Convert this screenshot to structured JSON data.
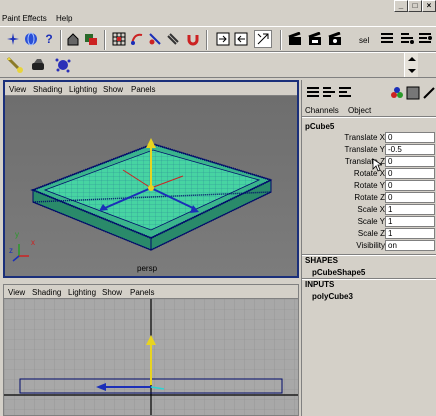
{
  "menubar": {
    "items": [
      "Paint Effects",
      "Help"
    ],
    "window_buttons": [
      "_",
      "□",
      "×"
    ]
  },
  "toolbar": {
    "sel_label": "sel"
  },
  "viewport_top": {
    "menu": [
      "View",
      "Shading",
      "Lighting",
      "Show",
      "Panels"
    ],
    "camera_label": "persp",
    "axis_labels": [
      "y",
      "x",
      "z"
    ]
  },
  "viewport_bottom": {
    "menu": [
      "View",
      "Shading",
      "Lighting",
      "Show",
      "Panels"
    ]
  },
  "channel_box": {
    "tabs": [
      "Channels",
      "Object"
    ],
    "object_name": "pCube5",
    "attributes": [
      {
        "label": "Translate X",
        "value": "0"
      },
      {
        "label": "Translate Y",
        "value": "-0.5"
      },
      {
        "label": "Translate Z",
        "value": "0"
      },
      {
        "label": "Rotate X",
        "value": "0"
      },
      {
        "label": "Rotate Y",
        "value": "0"
      },
      {
        "label": "Rotate Z",
        "value": "0"
      },
      {
        "label": "Scale X",
        "value": "1"
      },
      {
        "label": "Scale Y",
        "value": "1"
      },
      {
        "label": "Scale Z",
        "value": "1"
      },
      {
        "label": "Visibility",
        "value": "on"
      }
    ],
    "shapes_header": "SHAPES",
    "shape_name": "pCubeShape5",
    "inputs_header": "INPUTS",
    "input_name": "polyCube3"
  },
  "colors": {
    "active_border": "#1a2f7a",
    "mesh_fill": "#3fcf9c",
    "wire": "#000a6a"
  }
}
